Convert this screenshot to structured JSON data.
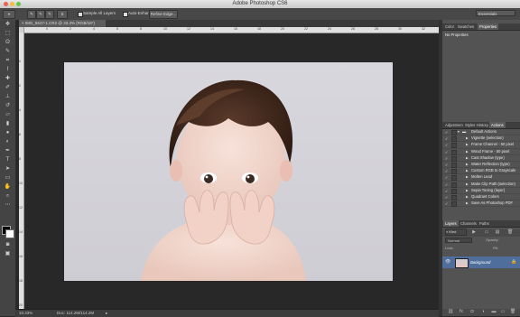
{
  "window": {
    "title": "Adobe Photoshop CS6"
  },
  "options_bar": {
    "sample_all_layers": "Sample All Layers",
    "auto_enhance": "Auto-Enhance",
    "refine_edge": "Refine Edge...",
    "brush_size": "5",
    "workspace": "Essentials"
  },
  "document": {
    "tab_title": "IMG_5647-1.CR2 @ 33.3% (RGB/16*)"
  },
  "ruler": {
    "h_ticks": [
      "2",
      "0",
      "2",
      "4",
      "6",
      "8",
      "10",
      "12",
      "14",
      "16",
      "18",
      "20",
      "22",
      "24",
      "26",
      "28",
      "30",
      "32"
    ],
    "v_ticks": [
      "0",
      "2",
      "4",
      "6",
      "8",
      "10",
      "12",
      "14",
      "16",
      "18",
      "20"
    ]
  },
  "status_bar": {
    "zoom": "33.33%",
    "doc_size": "Doc: 114.2M/114.2M"
  },
  "panels": {
    "top_tabs": [
      "Color",
      "Swatches",
      "Properties"
    ],
    "properties_label": "No Properties",
    "actions_tabs": [
      "Adjustmen",
      "Styles",
      "History",
      "Actions"
    ],
    "actions_group": "Default Actions",
    "actions": [
      "Vignette (selection)",
      "Frame Channel - 50 pixel",
      "Wood Frame - 50 pixel",
      "Cast Shadow (type)",
      "Water Reflection (type)",
      "Custom RGB to Grayscale",
      "Molten Lead",
      "Make Clip Path (selection)",
      "Sepia Toning (layer)",
      "Quadrant Colors",
      "Save As Photoshop PDF"
    ],
    "layers_tabs": [
      "Layers",
      "Channels",
      "Paths"
    ],
    "layers": {
      "kind_label": "Kind",
      "blend_mode": "Normal",
      "opacity_label": "Opacity:",
      "lock_label": "Lock:",
      "fill_label": "Fill:",
      "layer_name": "Background"
    }
  },
  "colors": {
    "selection": "#4f6e9c"
  }
}
